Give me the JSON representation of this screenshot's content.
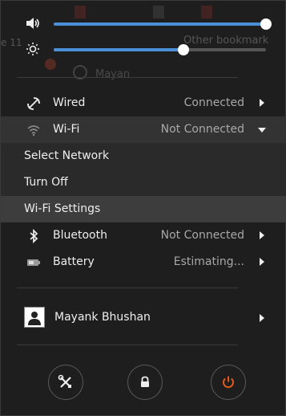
{
  "menu": {
    "volume_level": 1.0,
    "brightness_level": 0.61,
    "items": [
      {
        "label": "Wired",
        "status": "Connected",
        "icon": "wired-network-icon"
      },
      {
        "label": "Wi-Fi",
        "status": "Not Connected",
        "icon": "wifi-icon"
      }
    ],
    "wifi_submenu": [
      {
        "label": "Select Network"
      },
      {
        "label": "Turn Off"
      },
      {
        "label": "Wi-Fi Settings"
      }
    ],
    "items2": [
      {
        "label": "Bluetooth",
        "status": "Not Connected",
        "icon": "bluetooth-icon"
      },
      {
        "label": "Battery",
        "status": "Estimating...",
        "icon": "battery-icon"
      }
    ],
    "user": {
      "name": "Mayank Bhushan",
      "icon": "avatar-icon"
    },
    "actions": [
      {
        "name": "settings",
        "icon": "tools-icon"
      },
      {
        "name": "lock",
        "icon": "lock-icon"
      },
      {
        "name": "power",
        "icon": "power-icon"
      }
    ]
  },
  "background": {
    "bookmarks_label": "Other bookmark",
    "left_text": "e 11",
    "mid_text": "Mayan"
  },
  "colors": {
    "accent": "#4a90d9",
    "power": "#e25a1c"
  }
}
